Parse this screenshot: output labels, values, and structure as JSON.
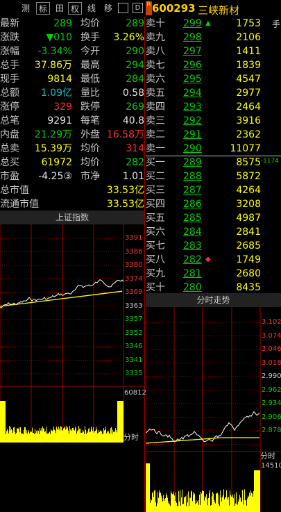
{
  "toolbar": {
    "items": [
      "测",
      "标",
      "田",
      "权",
      "线",
      "移",
      "",
      "D"
    ],
    "code": "600293",
    "name": "三峡新材",
    "badge": "R",
    "hand_char": "手"
  },
  "left_quote": [
    {
      "l1": "最新",
      "v1": "289",
      "c1": "green",
      "l2": "均价",
      "v2": "289",
      "c2": "green"
    },
    {
      "l1": "涨跌",
      "v1": "▼010",
      "c1": "green",
      "l2": "换手",
      "v2": "3.26%",
      "c2": "yellow"
    },
    {
      "l1": "涨幅",
      "v1": "-3.34%",
      "c1": "green",
      "l2": "今开",
      "v2": "290",
      "c2": "green"
    },
    {
      "l1": "总手",
      "v1": "37.86万",
      "c1": "yellow",
      "l2": "最高",
      "v2": "294",
      "c2": "green"
    },
    {
      "l1": "现手",
      "v1": "9814",
      "c1": "yellow",
      "l2": "最低",
      "v2": "284",
      "c2": "green"
    },
    {
      "l1": "总额",
      "v1": "1.09亿",
      "c1": "cyan",
      "l2": "量比",
      "v2": "0.58",
      "c2": "white"
    },
    {
      "l1": "涨停",
      "v1": "329",
      "c1": "red",
      "l2": "跌停",
      "v2": "269",
      "c2": "green"
    },
    {
      "l1": "总笔",
      "v1": "9291",
      "c1": "white",
      "l2": "每笔",
      "v2": "40.8",
      "c2": "white"
    },
    {
      "l1": "内盘",
      "v1": "21.29万",
      "c1": "green",
      "l2": "外盘",
      "v2": "16.58万",
      "c2": "red"
    },
    {
      "l1": "总卖",
      "v1": "15.39万",
      "c1": "yellow",
      "l2": "均价",
      "v2": "314",
      "c2": "red"
    },
    {
      "l1": "总买",
      "v1": "61972",
      "c1": "yellow",
      "l2": "均价",
      "v2": "282",
      "c2": "green"
    },
    {
      "l1": "市盈",
      "v1": "-4.25③",
      "c1": "white",
      "l2": "市净",
      "v2": "1.01",
      "c2": "white"
    }
  ],
  "market_cap": [
    {
      "label": "总市值",
      "value": "33.53亿"
    },
    {
      "label": "流通市值",
      "value": "33.53亿"
    }
  ],
  "order_book": {
    "sell": [
      {
        "label": "卖十",
        "price": "299",
        "vol": "1753",
        "mark": "▲"
      },
      {
        "label": "卖九",
        "price": "298",
        "vol": "2106",
        "mark": ""
      },
      {
        "label": "卖八",
        "price": "297",
        "vol": "1411",
        "mark": ""
      },
      {
        "label": "卖七",
        "price": "296",
        "vol": "1839",
        "mark": ""
      },
      {
        "label": "卖六",
        "price": "295",
        "vol": "4547",
        "mark": ""
      },
      {
        "label": "卖五",
        "price": "294",
        "vol": "2977",
        "mark": ""
      },
      {
        "label": "卖四",
        "price": "293",
        "vol": "2464",
        "mark": ""
      },
      {
        "label": "卖三",
        "price": "292",
        "vol": "3916",
        "mark": ""
      },
      {
        "label": "卖二",
        "price": "291",
        "vol": "2362",
        "mark": ""
      },
      {
        "label": "卖一",
        "price": "290",
        "vol": "11077",
        "mark": ""
      }
    ],
    "buy": [
      {
        "label": "买一",
        "price": "289",
        "vol": "8575",
        "mark": "-1174"
      },
      {
        "label": "买二",
        "price": "288",
        "vol": "5872",
        "mark": ""
      },
      {
        "label": "买三",
        "price": "287",
        "vol": "4264",
        "mark": ""
      },
      {
        "label": "买四",
        "price": "286",
        "vol": "3208",
        "mark": ""
      },
      {
        "label": "买五",
        "price": "285",
        "vol": "4987",
        "mark": ""
      },
      {
        "label": "买六",
        "price": "284",
        "vol": "2841",
        "mark": ""
      },
      {
        "label": "买七",
        "price": "283",
        "vol": "2685",
        "mark": ""
      },
      {
        "label": "买八",
        "price": "282",
        "vol": "1749",
        "mark": "◆"
      },
      {
        "label": "买九",
        "price": "281",
        "vol": "2680",
        "mark": ""
      },
      {
        "label": "买十",
        "price": "280",
        "vol": "8435",
        "mark": ""
      }
    ]
  },
  "index_chart": {
    "title": "上证指数",
    "y_ticks": [
      "3391",
      "3386",
      "3380",
      "3374",
      "3369",
      "3363",
      "3357",
      "3352",
      "3346",
      "3341",
      "3335"
    ],
    "vol_max": "60812",
    "footer": "分时"
  },
  "stock_chart": {
    "title": "分时走势",
    "y_ticks": [
      "3.102",
      "3.074",
      "3.046",
      "3.018",
      "2.990",
      "2.962",
      "2.934",
      "2.906",
      "2.878"
    ],
    "vol_max": "14510",
    "footer": "分时"
  },
  "colors": {
    "red": "#ff3232",
    "green": "#00d000",
    "yellow": "#ffff00",
    "grid": "#a00000",
    "price_line": "#ffffff",
    "avg_line": "#ffff00"
  }
}
